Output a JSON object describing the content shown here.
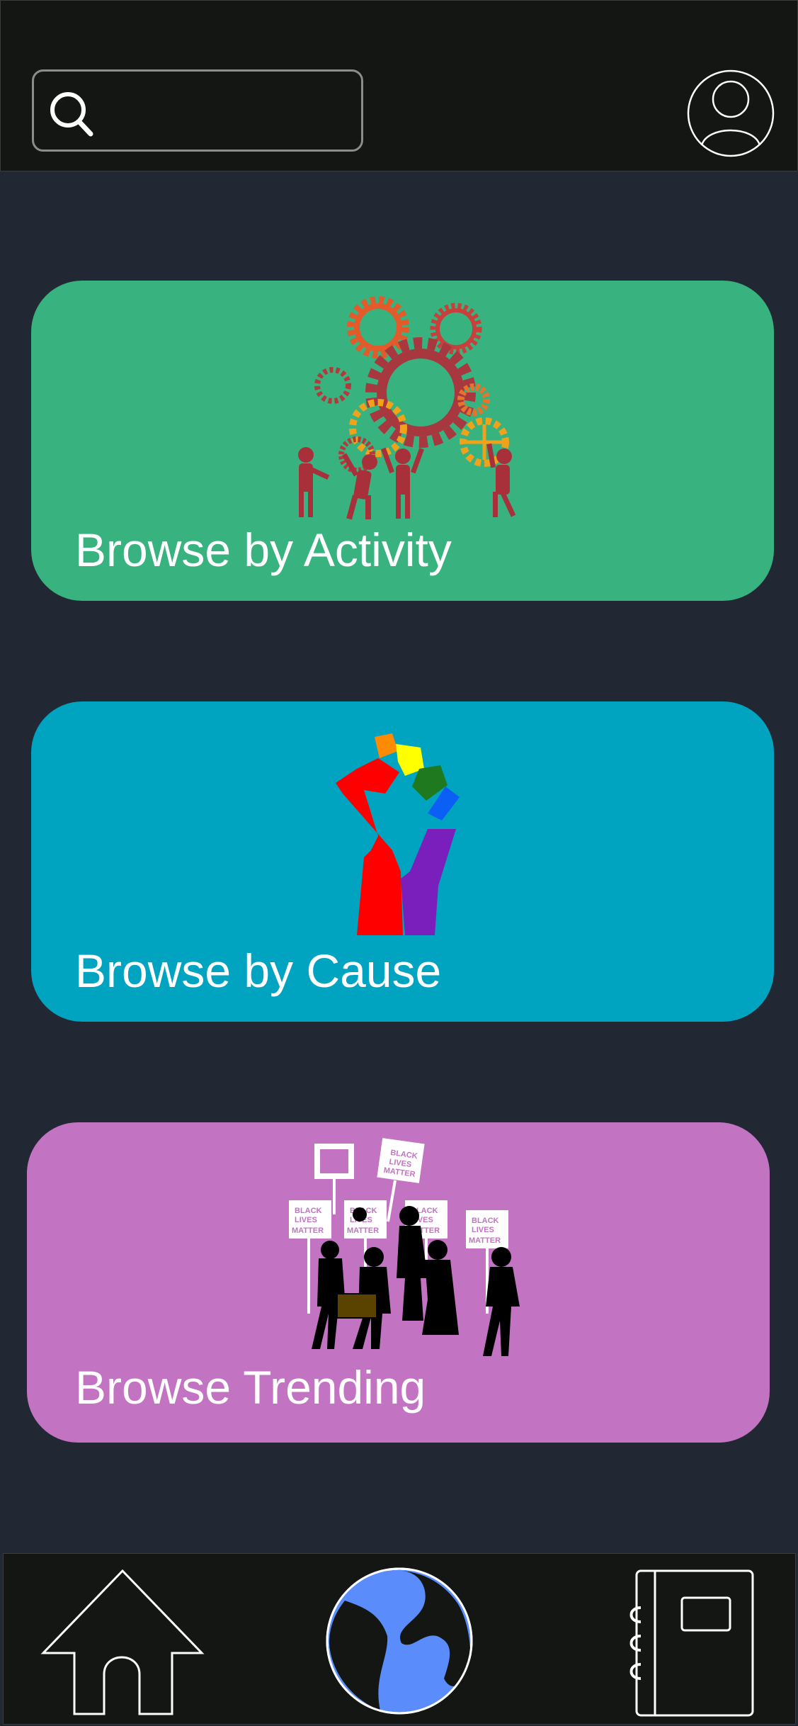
{
  "colors": {
    "background": "#212833",
    "bar": "#131612",
    "activity_card": "#38b27f",
    "cause_card": "#00a3c0",
    "trending_card": "#c273c1",
    "globe_accent": "#5b8cfb"
  },
  "header": {
    "search": {
      "value": "",
      "placeholder": "",
      "icon": "search-icon"
    },
    "profile_icon": "user-avatar-icon"
  },
  "cards": [
    {
      "label": "Browse by Activity",
      "icon": "gears-people-icon"
    },
    {
      "label": "Browse by Cause",
      "icon": "rainbow-fist-icon"
    },
    {
      "label": "Browse Trending",
      "icon": "protest-crowd-icon",
      "sign_text": [
        "BLACK",
        "LIVES",
        "MATTER"
      ]
    }
  ],
  "bottom_nav": [
    {
      "icon": "home-icon"
    },
    {
      "icon": "globe-icon",
      "active": true
    },
    {
      "icon": "notebook-icon"
    }
  ]
}
